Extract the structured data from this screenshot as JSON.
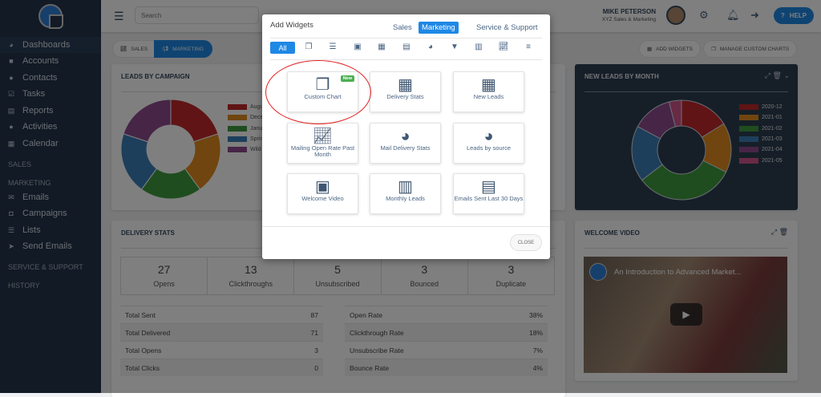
{
  "sidebar": {
    "items": [
      {
        "label": "Dashboards",
        "icon": "dashboard-icon"
      },
      {
        "label": "Accounts",
        "icon": "briefcase-icon"
      },
      {
        "label": "Contacts",
        "icon": "users-icon"
      },
      {
        "label": "Tasks",
        "icon": "checkbox-icon"
      },
      {
        "label": "Reports",
        "icon": "reports-icon"
      },
      {
        "label": "Activities",
        "icon": "chat-icon"
      },
      {
        "label": "Calendar",
        "icon": "calendar-icon"
      }
    ],
    "sales": "SALES",
    "marketing": "MARKETING",
    "marketing_items": [
      {
        "label": "Emails"
      },
      {
        "label": "Campaigns"
      },
      {
        "label": "Lists"
      },
      {
        "label": "Send Emails"
      }
    ],
    "service": "SERVICE & SUPPORT",
    "history": "HISTORY"
  },
  "topbar": {
    "search_placeholder": "Search",
    "user_name": "MIKE PETERSON",
    "user_org": "XYZ Sales & Marketing",
    "help": "HELP"
  },
  "toolbar": {
    "sales": "SALES",
    "marketing": "MARKETING",
    "add_widgets": "ADD WIDGETS",
    "manage_custom_charts": "MANAGE CUSTOM CHARTS"
  },
  "chart_data": [
    {
      "type": "pie",
      "title": "LEADS BY CAMPAIGN",
      "categories": [
        "Augu",
        "Dece",
        "Janu",
        "Sprin",
        "Wild"
      ],
      "values": [
        20,
        20,
        20,
        20,
        20
      ],
      "colors": [
        "#c0292b",
        "#e08a1e",
        "#3e9a3e",
        "#3a7fb8",
        "#8e4a8e"
      ]
    },
    {
      "type": "pie",
      "title": "NEW LEADS BY MONTH",
      "categories": [
        "2020-12",
        "2021-01",
        "2021-02",
        "2021-03",
        "2021-04",
        "2021-05"
      ],
      "values": [
        16,
        16,
        32,
        18,
        13,
        4
      ],
      "colors": [
        "#c0292b",
        "#e08a1e",
        "#3e9a3e",
        "#3a7fb8",
        "#8e4a8e",
        "#d0558a"
      ]
    }
  ],
  "delivery": {
    "title": "DELIVERY STATS",
    "stats": [
      {
        "value": "27",
        "label": "Opens"
      },
      {
        "value": "13",
        "label": "Clickthroughs"
      },
      {
        "value": "5",
        "label": "Unsubscribed"
      },
      {
        "value": "3",
        "label": "Bounced"
      },
      {
        "value": "3",
        "label": "Duplicate"
      }
    ],
    "left": [
      {
        "k": "Total Sent",
        "v": "87"
      },
      {
        "k": "Total Delivered",
        "v": "71"
      },
      {
        "k": "Total Opens",
        "v": "3"
      },
      {
        "k": "Total Clicks",
        "v": "0"
      }
    ],
    "right": [
      {
        "k": "Open Rate",
        "v": "38%"
      },
      {
        "k": "Clickthrough Rate",
        "v": "18%"
      },
      {
        "k": "Unsubscribe Rate",
        "v": "7%"
      },
      {
        "k": "Bounce Rate",
        "v": "4%"
      }
    ]
  },
  "video": {
    "title": "WELCOME VIDEO",
    "caption": "An Introduction to Advanced Market..."
  },
  "modal": {
    "title": "Add Widgets",
    "tabs": [
      "Sales",
      "Marketing",
      "Service & Support"
    ],
    "active_tab": "Marketing",
    "filter_all": "All",
    "tiles": [
      {
        "label": "Custom Chart",
        "badge": "New"
      },
      {
        "label": "Delivery Stats"
      },
      {
        "label": "New Leads"
      },
      {
        "label": "Mailing Open Rate Past Month"
      },
      {
        "label": "Mail Delivery Stats"
      },
      {
        "label": "Leads by source"
      },
      {
        "label": "Welcome Video"
      },
      {
        "label": "Monthly Leads"
      },
      {
        "label": "Emails Sent Last 30 Days"
      }
    ],
    "close": "CLOSE"
  }
}
